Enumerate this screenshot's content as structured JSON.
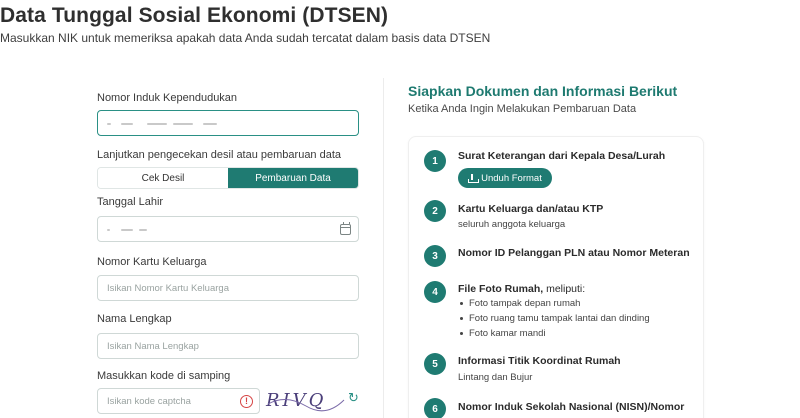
{
  "header": {
    "title": "Data Tunggal Sosial Ekonomi (DTSEN)",
    "subtitle": "Masukkan NIK untuk memeriksa apakah data Anda sudah tercatat dalam basis data DTSEN"
  },
  "form": {
    "nik_label": "Nomor Induk Kependudukan",
    "mode_label": "Lanjutkan pengecekan desil atau pembaruan data",
    "mode_options": [
      "Cek Desil",
      "Pembaruan Data"
    ],
    "mode_selected": "Pembaruan Data",
    "dob_label": "Tanggal Lahir",
    "kk_label": "Nomor Kartu Keluarga",
    "kk_placeholder": "Isikan Nomor Kartu Keluarga",
    "name_label": "Nama Lengkap",
    "name_placeholder": "Isikan Nama Lengkap",
    "captcha_label": "Masukkan kode di samping",
    "captcha_placeholder": "Isikan kode captcha",
    "captcha_text": "RIVQ"
  },
  "panel": {
    "title": "Siapkan Dokumen dan Informasi Berikut",
    "subtitle": "Ketika Anda Ingin Melakukan Pembaruan Data",
    "download_label": "Unduh Format",
    "steps": [
      {
        "num": "1",
        "title": "Surat Keterangan dari Kepala Desa/Lurah"
      },
      {
        "num": "2",
        "title": "Kartu Keluarga dan/atau KTP",
        "desc": "seluruh anggota keluarga"
      },
      {
        "num": "3",
        "title": "Nomor ID Pelanggan PLN atau Nomor Meteran"
      },
      {
        "num": "4",
        "title": "File Foto Rumah,",
        "title_suffix": " meliputi:",
        "bullets": [
          "Foto tampak depan rumah",
          "Foto ruang tamu tampak lantai dan dinding",
          "Foto kamar mandi"
        ]
      },
      {
        "num": "5",
        "title": "Informasi Titik Koordinat Rumah",
        "desc": "Lintang dan Bujur"
      },
      {
        "num": "6",
        "title": "Nomor Induk Sekolah Nasional (NISN)/Nomor"
      }
    ]
  },
  "colors": {
    "primary": "#1f7b72",
    "accent_text": "#1e7a70",
    "error": "#d64545"
  }
}
